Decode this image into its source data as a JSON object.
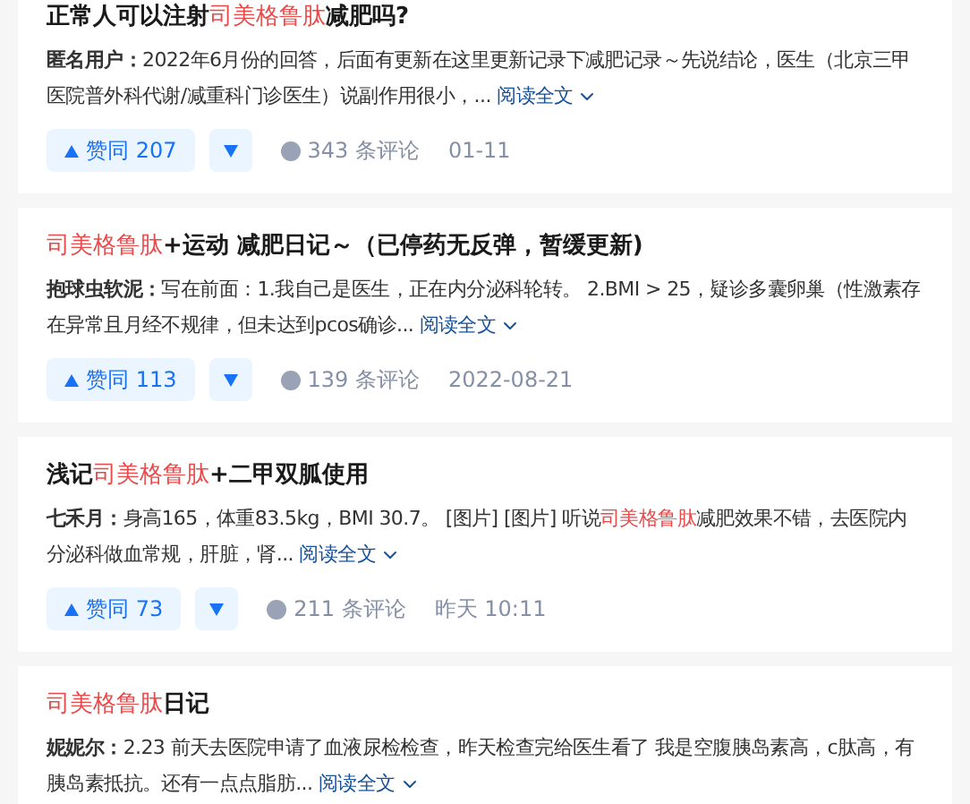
{
  "cards": [
    {
      "title": [
        {
          "text": "正常人可以注射",
          "highlight": false
        },
        {
          "text": "司美格鲁肽",
          "highlight": true
        },
        {
          "text": "减肥吗?",
          "highlight": false
        }
      ],
      "author": "匿名用户：",
      "excerpt": [
        {
          "text": "2022年6月份的回答，后面有更新在这里更新记录下减肥记录～先说结论，医生（北京三甲医院普外科代谢/减重科门诊医生）说副作用很小，...",
          "highlight": false
        }
      ],
      "read_more": "阅读全文",
      "upvote": "赞同 207",
      "comments": "343 条评论",
      "date": "01-11"
    },
    {
      "title": [
        {
          "text": "司美格鲁肽",
          "highlight": true
        },
        {
          "text": "+运动 减肥日记～（已停药无反弹，暂缓更新)",
          "highlight": false
        }
      ],
      "author": "抱球虫软泥：",
      "excerpt": [
        {
          "text": "写在前面：1.我自己是医生，正在内分泌科轮转。 2.BMI > 25，疑诊多囊卵巢（性激素存在异常且月经不规律，但未达到pcos确诊...",
          "highlight": false
        }
      ],
      "read_more": "阅读全文",
      "upvote": "赞同 113",
      "comments": "139 条评论",
      "date": "2022-08-21"
    },
    {
      "title": [
        {
          "text": "浅记",
          "highlight": false
        },
        {
          "text": "司美格鲁肽",
          "highlight": true
        },
        {
          "text": "+二甲双胍使用",
          "highlight": false
        }
      ],
      "author": "七禾月：",
      "excerpt": [
        {
          "text": "身高165，体重83.5kg，BMI 30.7。 [图片] [图片] 听说",
          "highlight": false
        },
        {
          "text": "司美格鲁肽",
          "highlight": true
        },
        {
          "text": "减肥效果不错，去医院内分泌科做血常规，肝脏，肾...",
          "highlight": false
        }
      ],
      "read_more": "阅读全文",
      "upvote": "赞同 73",
      "comments": "211 条评论",
      "date": "昨天 10:11"
    },
    {
      "title": [
        {
          "text": "司美格鲁肽",
          "highlight": true
        },
        {
          "text": "日记",
          "highlight": false
        }
      ],
      "author": "妮妮尔：",
      "excerpt": [
        {
          "text": "2.23 前天去医院申请了血液尿检检查，昨天检查完给医生看了 我是空腹胰岛素高，c肽高，有胰岛素抵抗。还有一点点脂肪...",
          "highlight": false
        }
      ],
      "read_more": "阅读全文"
    }
  ]
}
